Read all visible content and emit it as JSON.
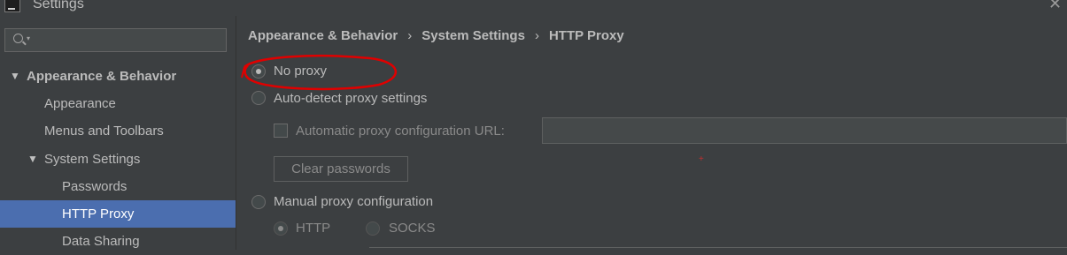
{
  "window": {
    "title": "Settings"
  },
  "sidebar": {
    "search_placeholder": "",
    "items": [
      {
        "label": "Appearance & Behavior",
        "level": 0,
        "expanded": true
      },
      {
        "label": "Appearance",
        "level": 1
      },
      {
        "label": "Menus and Toolbars",
        "level": 1
      },
      {
        "label": "System Settings",
        "level": 1,
        "expanded": true
      },
      {
        "label": "Passwords",
        "level": 2
      },
      {
        "label": "HTTP Proxy",
        "level": 2,
        "selected": true
      },
      {
        "label": "Data Sharing",
        "level": 2
      }
    ]
  },
  "breadcrumb": [
    "Appearance & Behavior",
    "System Settings",
    "HTTP Proxy"
  ],
  "proxy": {
    "no_proxy_label": "No proxy",
    "no_proxy_selected": true,
    "auto_detect_label": "Auto-detect proxy settings",
    "auto_config_url_label": "Automatic proxy configuration URL:",
    "auto_config_url_value": "",
    "clear_passwords_label": "Clear passwords",
    "manual_label": "Manual proxy configuration",
    "http_label": "HTTP",
    "socks_label": "SOCKS"
  },
  "colors": {
    "background": "#3c3f41",
    "selection": "#4b6eaf",
    "annotation": "#e00000"
  }
}
